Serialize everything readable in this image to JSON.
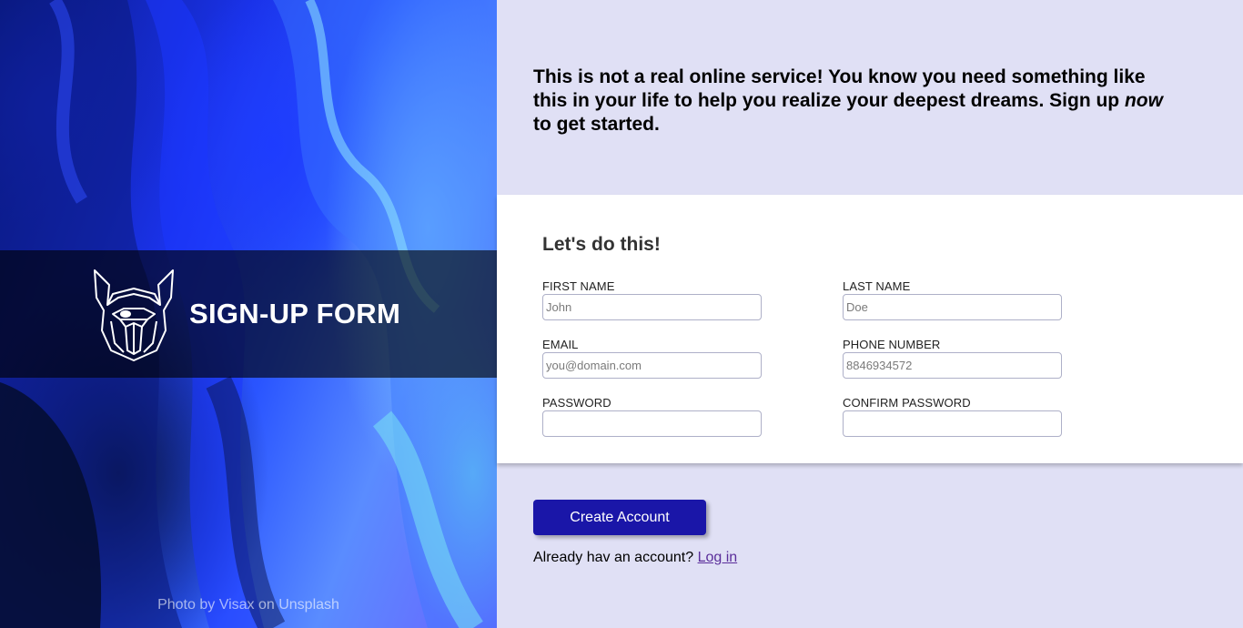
{
  "hero": {
    "title": "SIGN-UP FORM",
    "logo_icon": "viking-head-icon",
    "credit_prefix": "Photo by ",
    "credit_author": "Visax",
    "credit_middle": " on ",
    "credit_source": "Unsplash"
  },
  "intro": {
    "line1": "This is not a real online service! You know you need something like this in your life to help you realize your deepest dreams. Sign up ",
    "emphasis": "now",
    "line2": " to get started."
  },
  "form": {
    "heading": "Let's do this!",
    "first_name": {
      "label": "FIRST NAME",
      "placeholder": "John",
      "value": ""
    },
    "last_name": {
      "label": "LAST NAME",
      "placeholder": "Doe",
      "value": ""
    },
    "email": {
      "label": "EMAIL",
      "placeholder": "you@domain.com",
      "value": ""
    },
    "phone": {
      "label": "PHONE NUMBER",
      "placeholder": "8846934572",
      "value": ""
    },
    "password": {
      "label": "PASSWORD",
      "placeholder": "",
      "value": ""
    },
    "confirm_password": {
      "label": "CONFIRM PASSWORD",
      "placeholder": "",
      "value": ""
    }
  },
  "actions": {
    "create_label": "Create Account",
    "login_prompt": "Already hav an account? ",
    "login_link": "Log in"
  },
  "colors": {
    "right_bg": "#e0e0f5",
    "button_bg": "#1a16a8",
    "link": "#5a2d9a"
  }
}
